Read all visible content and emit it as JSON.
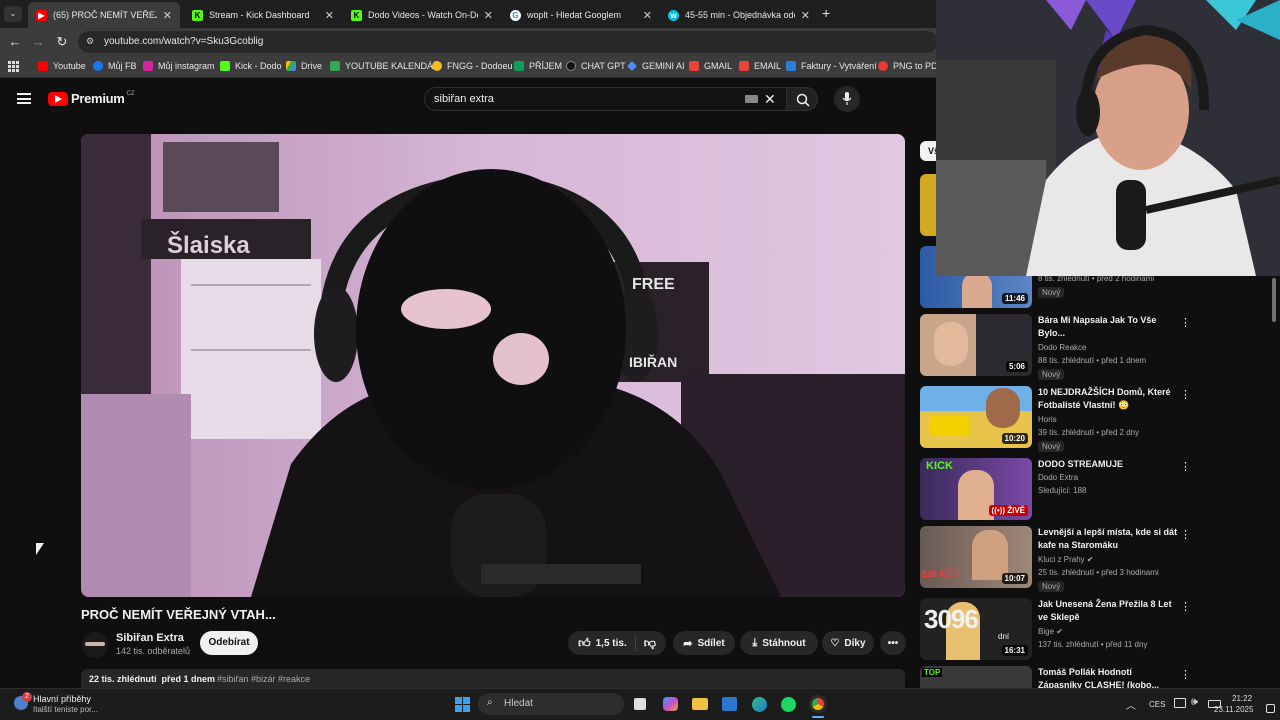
{
  "browser": {
    "tabs": [
      {
        "title": "(65) PROČ NEMÍT VEŘEJNÝ VTAH...",
        "active": true
      },
      {
        "title": "Stream - Kick Dashboard",
        "active": false
      },
      {
        "title": "Dodo Videos - Watch On-Demand",
        "active": false
      },
      {
        "title": "woplt - Hledat Googlem",
        "active": false
      },
      {
        "title": "45-55 min - Objednávka odeslána",
        "active": false
      }
    ],
    "new_tab": "+",
    "url": "youtube.com/watch?v=Sku3Gcoblig",
    "bookmarks": [
      {
        "label": "Youtube",
        "color": "#ff0000"
      },
      {
        "label": "Můj FB",
        "color": "#1877f2"
      },
      {
        "label": "Můj instagram",
        "color": "#d6249f"
      },
      {
        "label": "Kick - Dodo",
        "color": "#53fc18"
      },
      {
        "label": "Drive",
        "color": "#fbbc04"
      },
      {
        "label": "YOUTUBE KALENDÁŘ",
        "color": "#34a853"
      },
      {
        "label": "FNGG - Dodoeu",
        "color": "#f0c020"
      },
      {
        "label": "PŘÍJEM",
        "color": "#0f9d58"
      },
      {
        "label": "CHAT GPT",
        "color": "#222222"
      },
      {
        "label": "GEMINI AI",
        "color": "#4f8ef7"
      },
      {
        "label": "GMAIL",
        "color": "#ea4335"
      },
      {
        "label": "EMAIL",
        "color": "#ea4335"
      },
      {
        "label": "Faktury - Vytváření",
        "color": "#2b7fd4"
      },
      {
        "label": "PNG to PDF",
        "color": "#e53935"
      }
    ]
  },
  "youtube": {
    "logo": "Premium",
    "region": "CZ",
    "search_value": "sibiřan extra",
    "video": {
      "title": "PROČ NEMÍT VEŘEJNÝ VTAH...",
      "channel": "Sibiřan Extra",
      "subscribers": "142 tis. odběratelů",
      "subscribe_label": "Odebírat",
      "likes": "1,5 tis.",
      "share_label": "Sdílet",
      "download_label": "Stáhnout",
      "thanks_label": "Díky",
      "views_date": "22 tis. zhlédnutí  před 1 dnem",
      "hashtags": "#sibiřan #bizár #reakce",
      "overlay_sign": "Šlaiska",
      "overlay_poster_top": "FREE",
      "overlay_poster_bottom": "IBIŘAN"
    },
    "filter_chip": "Vš",
    "recommendations": [
      {
        "title": "",
        "channel": "",
        "meta": "8 tis. zhlédnutí • před 2 hodinami",
        "badge": "Nový",
        "duration": "11:46"
      },
      {
        "title": "Bára Mi Napsala Jak To Vše Bylo...",
        "channel": "Dodo Reakce",
        "meta": "88 tis. zhlédnutí • před 1 dnem",
        "badge": "Nový",
        "duration": "5:06"
      },
      {
        "title": "10 NEJDRAŽŠÍCH Domů, Které Fotbalisté Vlastní! 😳",
        "channel": "Horis",
        "meta": "39 tis. zhlédnutí • před 2 dny",
        "badge": "Nový",
        "duration": "10:20"
      },
      {
        "title": "DODO STREAMUJE",
        "channel": "Dodo Extra",
        "meta": "Sledující: 188",
        "badge": "",
        "duration": "ŽIVĚ",
        "thumb_text": "KICK"
      },
      {
        "title": "Levnější a lepší místa, kde si dát kafe na Staromáku",
        "channel": "Kluci z Prahy",
        "meta": "25 tis. zhlédnutí • před 3 hodinami",
        "badge": "Nový",
        "duration": "10:07",
        "thumb_text": "130 KČ?!"
      },
      {
        "title": "Jak Unesená Žena Přežila 8 Let ve Sklepě",
        "channel": "Bige",
        "meta": "137 tis. zhlédnutí • před 11 dny",
        "badge": "",
        "duration": "16:31",
        "thumb_text": "3096",
        "thumb_sub": "dní"
      },
      {
        "title": "Tomáš Pollák Hodnotí Zápasníky CLASHE! (kobo...",
        "channel": "",
        "meta": "",
        "badge": "",
        "duration": "",
        "thumb_text": "TOP"
      }
    ]
  },
  "taskbar": {
    "news_title": "Hlavní příběhy",
    "news_sub": "Italští teniste por...",
    "news_count": "2",
    "search_placeholder": "Hledat",
    "language": "CES",
    "time": "21:22",
    "date": "23.11.2025"
  }
}
